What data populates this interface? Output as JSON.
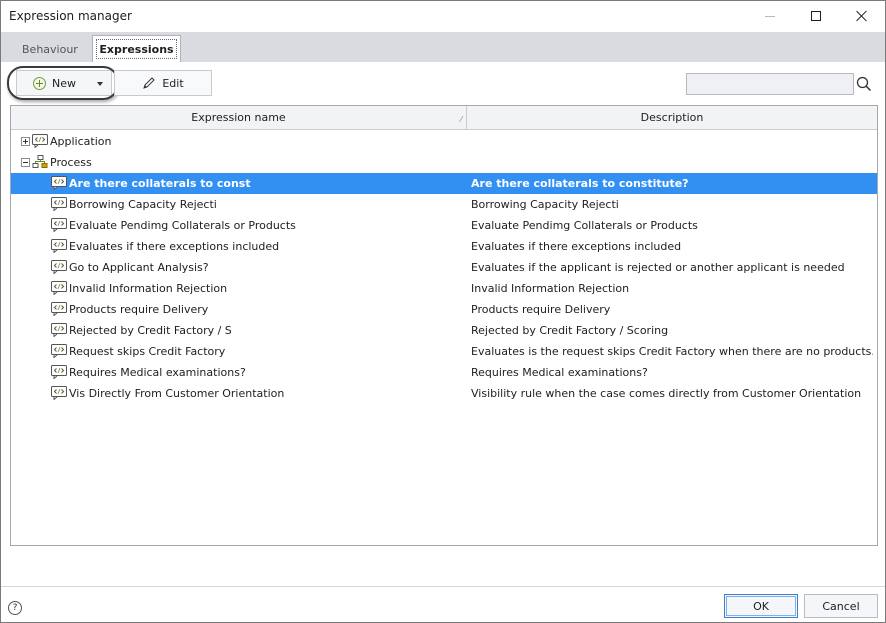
{
  "window": {
    "title": "Expression manager"
  },
  "tabs": [
    {
      "label": "Behaviour",
      "active": false
    },
    {
      "label": "Expressions",
      "active": true
    }
  ],
  "toolbar": {
    "new_label": "New",
    "edit_label": "Edit",
    "search_value": ""
  },
  "grid": {
    "columns": [
      "Expression name",
      "Description"
    ],
    "groups": [
      {
        "label": "Application",
        "expanded": false,
        "icon": "expression-icon"
      },
      {
        "label": "Process",
        "expanded": true,
        "icon": "process-icon"
      }
    ],
    "rows": [
      {
        "name": "Are there collaterals to const",
        "description": "Are there collaterals to constitute?",
        "selected": true
      },
      {
        "name": "Borrowing Capacity Rejecti",
        "description": "Borrowing Capacity Rejecti"
      },
      {
        "name": "Evaluate Pendimg Collaterals or Products",
        "description": "Evaluate Pendimg Collaterals or Products"
      },
      {
        "name": "Evaluates if there exceptions included",
        "description": "Evaluates if there exceptions included"
      },
      {
        "name": "Go to Applicant Analysis?",
        "description": "Evaluates if the applicant is rejected or another applicant is needed"
      },
      {
        "name": "Invalid Information Rejection",
        "description": "Invalid Information Rejection"
      },
      {
        "name": "Products require Delivery",
        "description": "Products require Delivery"
      },
      {
        "name": "Rejected by Credit Factory / S",
        "description": "Rejected by Credit Factory / Scoring"
      },
      {
        "name": "Request skips Credit Factory",
        "description": "Evaluates is the request skips Credit Factory when there are no products..."
      },
      {
        "name": "Requires Medical examinations?",
        "description": "Requires Medical examinations?"
      },
      {
        "name": "Vis Directly From Customer Orientation",
        "description": "Visibility rule when the case comes directly from Customer Orientation"
      }
    ]
  },
  "footer": {
    "help_glyph": "?",
    "ok_label": "OK",
    "cancel_label": "Cancel"
  },
  "colors": {
    "selection": "#3390f3",
    "tab_strip": "#d9dbe0"
  }
}
